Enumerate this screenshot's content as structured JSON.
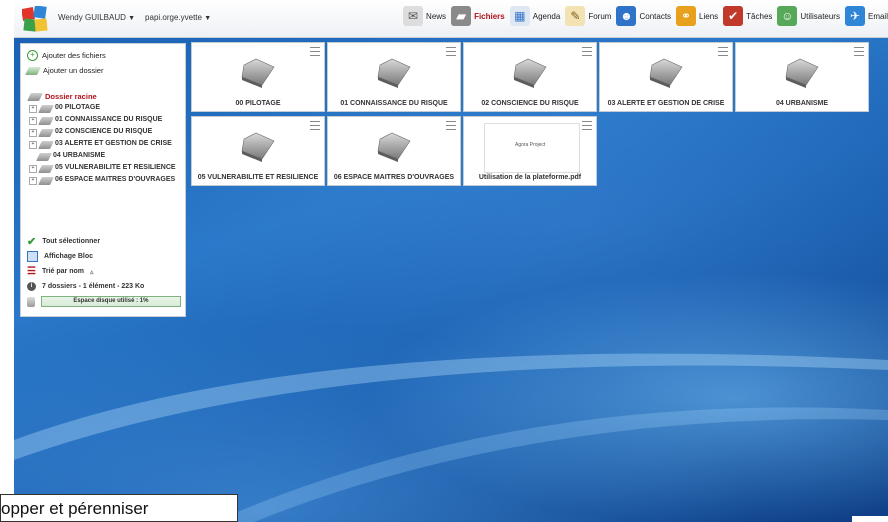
{
  "header": {
    "user_name": "Wendy GUILBAUD",
    "space_name": "papi.orge.yvette",
    "modules": [
      {
        "label": "News",
        "icon": "news-icon",
        "active": false
      },
      {
        "label": "Fichiers",
        "icon": "folder-icon",
        "active": true
      },
      {
        "label": "Agenda",
        "icon": "calendar-icon",
        "active": false
      },
      {
        "label": "Forum",
        "icon": "forum-icon",
        "active": false
      },
      {
        "label": "Contacts",
        "icon": "contacts-icon",
        "active": false
      },
      {
        "label": "Liens",
        "icon": "links-icon",
        "active": false
      },
      {
        "label": "Tâches",
        "icon": "tasks-icon",
        "active": false
      },
      {
        "label": "Utilisateurs",
        "icon": "users-icon",
        "active": false
      },
      {
        "label": "Email",
        "icon": "email-icon",
        "active": false
      }
    ]
  },
  "sidebar": {
    "add_files": "Ajouter des fichiers",
    "add_folder": "Ajouter un dossier",
    "root": "Dossier racine",
    "tree": [
      "00 PILOTAGE",
      "01 CONNAISSANCE DU RISQUE",
      "02 CONSCIENCE DU RISQUE",
      "03 ALERTE ET GESTION DE CRISE",
      "04 URBANISME",
      "05 VULNERABILITE ET RESILIENCE",
      "06 ESPACE MAITRES D'OUVRAGES"
    ],
    "select_all": "Tout sélectionner",
    "display_mode": "Affichage Bloc",
    "sort": "Trié par nom",
    "summary": "7 dossiers - 1 élément - 223 Ko",
    "disk_usage": "Espace disque utilisé : 1%"
  },
  "tiles": [
    {
      "label": "00 PILOTAGE",
      "kind": "folder"
    },
    {
      "label": "01 CONNAISSANCE DU RISQUE",
      "kind": "folder"
    },
    {
      "label": "02 CONSCIENCE DU RISQUE",
      "kind": "folder"
    },
    {
      "label": "03 ALERTE ET GESTION DE CRISE",
      "kind": "folder"
    },
    {
      "label": "04 URBANISME",
      "kind": "folder"
    },
    {
      "label": "05 VULNERABILITE ET RESILIENCE",
      "kind": "folder"
    },
    {
      "label": "06 ESPACE MAITRES D'OUVRAGES",
      "kind": "folder"
    },
    {
      "label": "Utilisation de la plateforme.pdf",
      "kind": "file",
      "preview_text": "Agora Project"
    }
  ],
  "caption": "opper et pérenniser",
  "colors": {
    "accent": "#b1121b",
    "desktop": "#1b62b4"
  }
}
